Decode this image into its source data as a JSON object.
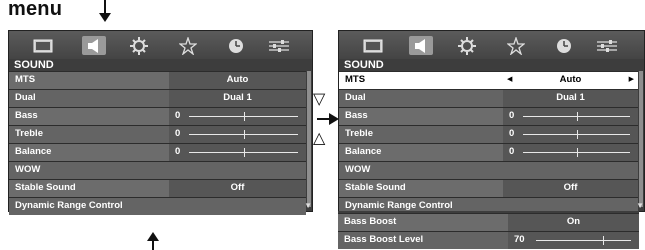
{
  "caption": {
    "menu_word": "menu"
  },
  "nav_symbols": {
    "down": "▽",
    "up": "△"
  },
  "icons": [
    "picture-icon",
    "sound-icon",
    "setup-icon",
    "feature-icon",
    "timer-icon",
    "adjust-icon"
  ],
  "left_panel": {
    "title": "SOUND",
    "rows": [
      {
        "label": "MTS",
        "value": "Auto",
        "type": "option"
      },
      {
        "label": "Dual",
        "value": "Dual 1",
        "type": "option"
      },
      {
        "label": "Bass",
        "value": "0",
        "type": "slider",
        "level": 0.5
      },
      {
        "label": "Treble",
        "value": "0",
        "type": "slider",
        "level": 0.5
      },
      {
        "label": "Balance",
        "value": "0",
        "type": "slider",
        "level": 0.5
      },
      {
        "label": "WOW",
        "value": "",
        "type": "header"
      },
      {
        "label": "Stable Sound",
        "value": "Off",
        "type": "option"
      },
      {
        "label": "Dynamic Range Control",
        "value": "",
        "type": "item"
      }
    ]
  },
  "right_panel": {
    "title": "SOUND",
    "highlighted": "MTS",
    "rows": [
      {
        "label": "MTS",
        "value": "Auto",
        "type": "option"
      },
      {
        "label": "Dual",
        "value": "Dual 1",
        "type": "option"
      },
      {
        "label": "Bass",
        "value": "0",
        "type": "slider",
        "level": 0.5
      },
      {
        "label": "Treble",
        "value": "0",
        "type": "slider",
        "level": 0.5
      },
      {
        "label": "Balance",
        "value": "0",
        "type": "slider",
        "level": 0.5
      },
      {
        "label": "WOW",
        "value": "",
        "type": "header"
      },
      {
        "label": "Stable Sound",
        "value": "Off",
        "type": "option"
      },
      {
        "label": "Dynamic Range Control",
        "value": "",
        "type": "item"
      }
    ],
    "extension_rows": [
      {
        "label": "Bass Boost",
        "value": "On",
        "type": "option"
      },
      {
        "label": "Bass Boost Level",
        "value": "70",
        "type": "slider",
        "level": 0.7
      }
    ]
  },
  "colors": {
    "panel_bg": "#3d3d3d",
    "row_bg": "#6c6c6c",
    "highlight_bg": "#ffffff",
    "text": "#ffffff"
  }
}
